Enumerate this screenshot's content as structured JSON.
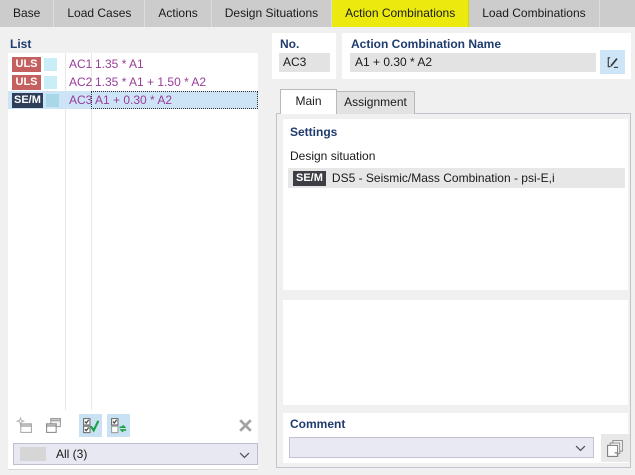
{
  "top_tabs": {
    "items": [
      {
        "label": "Base",
        "active": false
      },
      {
        "label": "Load Cases",
        "active": false
      },
      {
        "label": "Actions",
        "active": false
      },
      {
        "label": "Design Situations",
        "active": false
      },
      {
        "label": "Action Combinations",
        "active": true
      },
      {
        "label": "Load Combinations",
        "active": false
      }
    ]
  },
  "list": {
    "title": "List",
    "rows": [
      {
        "category": "ULS",
        "category_bg": "#c4605f",
        "swatch": "#c9eef7",
        "id": "AC1",
        "formula": "1.35 * A1",
        "selected": false
      },
      {
        "category": "ULS",
        "category_bg": "#c4605f",
        "swatch": "#c9eef7",
        "id": "AC2",
        "formula": "1.35 * A1 + 1.50 * A2",
        "selected": false
      },
      {
        "category": "SE/M",
        "category_bg": "#2e3e58",
        "swatch": "#a8d8e8",
        "id": "AC3",
        "formula": "A1 + 0.30 * A2",
        "selected": true
      }
    ],
    "filter_value": "All (3)"
  },
  "details": {
    "no_label": "No.",
    "no_value": "AC3",
    "name_label": "Action Combination Name",
    "name_value": "A1 + 0.30 * A2",
    "tabs": [
      {
        "label": "Main",
        "active": true
      },
      {
        "label": "Assignment",
        "active": false
      }
    ],
    "settings_title": "Settings",
    "design_situation_label": "Design situation",
    "design_situation": {
      "badge": "SE/M",
      "badge_bg": "#3d3d44",
      "text": "DS5 - Seismic/Mass Combination - psi-E,i"
    },
    "comment_label": "Comment",
    "comment_value": ""
  },
  "colors": {
    "active_tab": "#ebe90e",
    "header_text": "#1e3c6e",
    "combination_text": "#9a3c9a",
    "selected_row": "#cde4f7",
    "toolbar_highlight": "#c9e2f3",
    "uls_badge": "#c4605f",
    "sem_badge_list": "#2e3e58",
    "sem_badge_settings": "#3d3d44"
  },
  "icons": {
    "toolbar": [
      "new-combination-icon",
      "copy-combination-icon",
      "check-all-icon",
      "invert-selection-icon",
      "delete-icon"
    ],
    "name_edit": "rename-icon",
    "comment_copy": "copy-pages-icon",
    "dropdown": "chevron-down-icon"
  }
}
